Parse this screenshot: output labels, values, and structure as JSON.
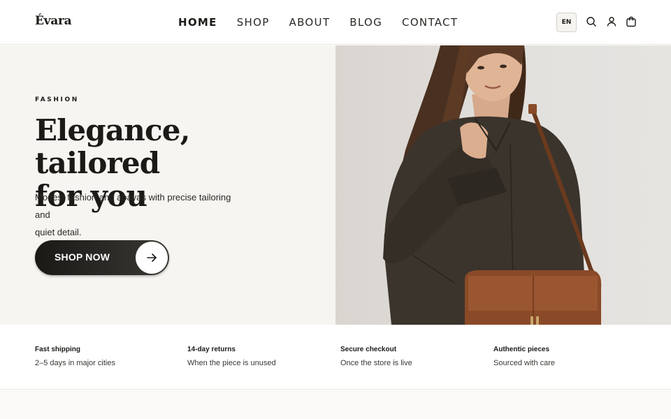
{
  "header": {
    "logo": "Évara",
    "nav": [
      {
        "label": "HOME",
        "active": true
      },
      {
        "label": "SHOP",
        "active": false
      },
      {
        "label": "ABOUT",
        "active": false
      },
      {
        "label": "BLOG",
        "active": false
      },
      {
        "label": "CONTACT",
        "active": false
      }
    ],
    "language": "EN",
    "icons": [
      "search-icon",
      "user-icon",
      "cart-icon"
    ]
  },
  "hero": {
    "eyebrow": "FASHION",
    "title_line1": "Elegance, tailored",
    "title_line2": "for you",
    "subtitle_line1": "Modest fashion and abayas with precise tailoring and",
    "subtitle_line2": "quiet detail.",
    "cta_label": "SHOP NOW",
    "cta_icon": "arrow-right-icon",
    "image": "woman-in-dark-jacket-with-brown-shoulder-bag"
  },
  "features": [
    {
      "title": "Fast shipping",
      "desc": "2–5 days in major cities"
    },
    {
      "title": "14-day returns",
      "desc": "When the piece is unused"
    },
    {
      "title": "Secure checkout",
      "desc": "Once the store is live"
    },
    {
      "title": "Authentic pieces",
      "desc": "Sourced with care"
    }
  ],
  "colors": {
    "text": "#1c1a17",
    "hero_bg": "#f7f5f1",
    "cta_bg": "#1a1916",
    "accent_leather": "#8a4a28"
  }
}
